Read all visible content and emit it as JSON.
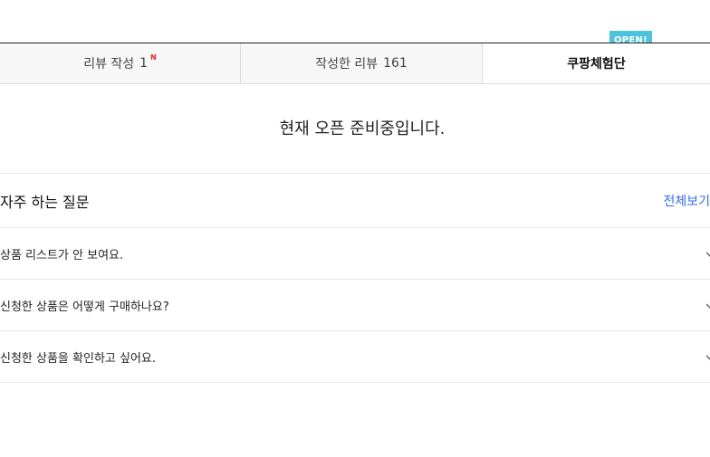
{
  "tabs": [
    {
      "label": "리뷰 작성",
      "count": "1",
      "badge": "N"
    },
    {
      "label": "작성한 리뷰",
      "count": "161"
    },
    {
      "label": "쿠팡체험단",
      "flag": "OPEN!"
    }
  ],
  "notice": "현재 오픈 준비중입니다.",
  "faq": {
    "title": "자주 하는 질문",
    "more": "전체보기",
    "items": [
      {
        "question": "상품 리스트가 안 보여요."
      },
      {
        "question": "신청한 상품은 어떻게 구매하나요?"
      },
      {
        "question": "신청한 상품을 확인하고 싶어요."
      }
    ]
  },
  "colors": {
    "accent_link": "#346aff",
    "badge_red": "#e52528",
    "open_flag": "#4cc3de"
  },
  "icons": {
    "faq_item_expand": "chevron-down-icon"
  }
}
